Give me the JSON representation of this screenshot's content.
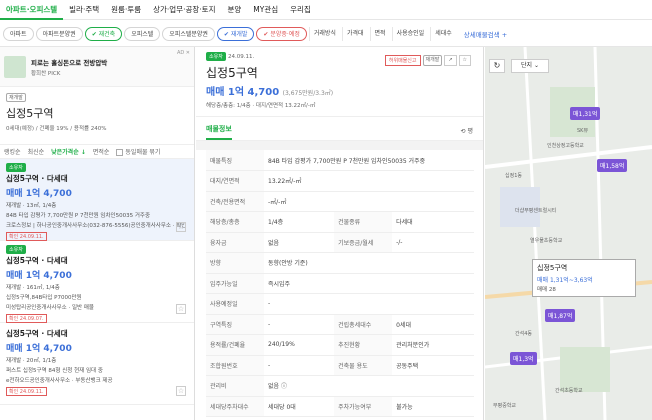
{
  "topnav": [
    "아파트·오피스텔",
    "빌라·주택",
    "원룸·투룸",
    "상가·업무·공장·토지",
    "분양",
    "MY관심",
    "우리집"
  ],
  "filters": [
    "아파트",
    "아파트분양권",
    "재건축",
    "오피스텔",
    "오피스텔분양권",
    "재개발",
    "분양중·예정"
  ],
  "filter_selects": [
    "거래방식",
    "가격대",
    "면적",
    "사용승인일",
    "세대수"
  ],
  "filter_link": "상세매물검색 +",
  "ad": {
    "title": "피로는 홀싱돈으로 전방압박",
    "sub": "황희찬 PICK",
    "tag": "AD ✕"
  },
  "summary": {
    "tag": "재개발",
    "title": "십정5구역",
    "meta": "0세대(예정) / 건폐율 19% / 용적률 240%"
  },
  "sort": [
    "랭킹순",
    "최신순",
    "낮은가격순 ↓",
    "면적순"
  ],
  "sort_check": "동일매물 묶기",
  "listings": [
    {
      "tag": "소유자",
      "title": "십정5구역 · 다세대",
      "price": "매매 1억 4,700",
      "line1": "재개발 · 13㎡, 1/4층",
      "line2": "84B 타입 감평가 7,700만원 P 7천만원 임차인50035 거주중",
      "line3": "크로스정보 | 하나공인중개사사무소(032-876-5556)공인중개사사무소 · 확인 매물",
      "date": "확인 24.09.11."
    },
    {
      "tag": "소유자",
      "title": "십정5구역 · 다세대",
      "price": "매매 1억 4,700",
      "line1": "재개발 · 161㎡, 1/4층",
      "line2": "십정5구역,84B타입 P7000만원",
      "line3": "미성탑리공인중개사사무소 · 일반 매물",
      "date": "확인 24.09.07."
    },
    {
      "tag": "",
      "title": "십정5구역 · 다세대",
      "price": "매매 1억 4,700",
      "line1": "재개발 · 20㎡, 1/1층",
      "line2": "퍼스트 십정5구역 84형 신청 현재 임대 중",
      "line3": "e전하오드공인중개사사무소 · 부동산뱅크 제공",
      "date": "확인 24.09.11."
    }
  ],
  "detail": {
    "tag": "소유자",
    "date": "24.09.11.",
    "badge": "재개발",
    "title": "십정5구역",
    "price": "매매 1억 4,700",
    "ppm": "(3,675만원/3.3㎡)",
    "sub": "해당층/총층: 1/4층 · 대지/연면적 13.22㎡/-㎡",
    "btn1": "허위매물신고",
    "btn2": "↗",
    "btn3": "☆",
    "tab": "매물정보",
    "tab_r": "⟲ 평"
  },
  "rows": [
    [
      "매물특징",
      "84B 타입 감평가 7,700만원 P 7천만원 임차인50035 거주중",
      "",
      ""
    ],
    [
      "대지/연면적",
      "13.22㎡/-㎡",
      "",
      ""
    ],
    [
      "건축/전용면적",
      "-㎡/-㎡",
      "",
      ""
    ],
    [
      "해당층/총층",
      "1/4층",
      "건물종류",
      "다세대"
    ],
    [
      "융자금",
      "없음",
      "기보증금/월세",
      "-/-"
    ],
    [
      "방향",
      "동향(안방 기준)",
      "",
      ""
    ],
    [
      "입주가능일",
      "즉시입주",
      "",
      ""
    ],
    [
      "사용예정일",
      "-",
      "",
      ""
    ],
    [
      "구역특징",
      "-",
      "건립총세대수",
      "0세대"
    ],
    [
      "용적률/건폐율",
      "240/19%",
      "추진현황",
      "관리처분인가"
    ],
    [
      "조합원번호",
      "-",
      "건축물 용도",
      "공동주택"
    ],
    [
      "관리비",
      "없음 ⓘ",
      "",
      ""
    ],
    [
      "세대당주차대수",
      "세대당 0대",
      "주차가능여부",
      "불가능"
    ]
  ],
  "map": {
    "zoom": "↻",
    "select": "단지 ⌄",
    "markers": [
      "매1,31억",
      "매1,58억",
      "매1,87억",
      "매1,3억"
    ],
    "popup": {
      "title": "십정5구역",
      "price": "매매 1,31억~3,63억",
      "count": "매매 28"
    },
    "pois": [
      "인천상정고등학교",
      "SK뷰",
      "십정1동",
      "더샵부평센트럴시티",
      "열우물초등학교",
      "간석4동",
      "간석초등학교",
      "부평중학교"
    ]
  }
}
